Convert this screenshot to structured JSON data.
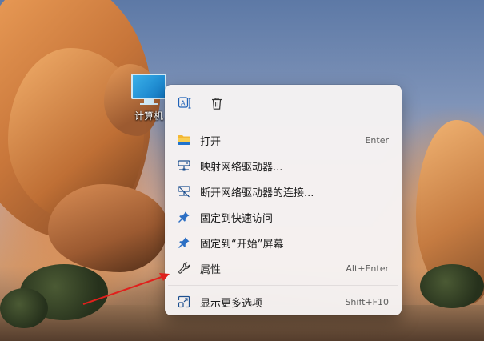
{
  "desktop_icon": {
    "label": "计算机"
  },
  "quick_actions": [
    {
      "name": "rename",
      "icon": "rename-icon"
    },
    {
      "name": "delete",
      "icon": "trash-icon"
    }
  ],
  "menu": {
    "items": [
      {
        "label": "打开",
        "accelerator": "Enter",
        "icon": "folder-icon"
      },
      {
        "label": "映射网络驱动器...",
        "accelerator": "",
        "icon": "network-drive-icon"
      },
      {
        "label": "断开网络驱动器的连接...",
        "accelerator": "",
        "icon": "disconnect-drive-icon"
      },
      {
        "label": "固定到快速访问",
        "accelerator": "",
        "icon": "pin-icon"
      },
      {
        "label": "固定到“开始”屏幕",
        "accelerator": "",
        "icon": "pin-icon"
      },
      {
        "label": "属性",
        "accelerator": "Alt+Enter",
        "icon": "wrench-icon"
      }
    ],
    "more": {
      "label": "显示更多选项",
      "accelerator": "Shift+F10",
      "icon": "show-more-icon"
    }
  },
  "colors": {
    "accent": "#0a5fc7",
    "menu_bg": "#f6f3f3",
    "arrow": "#e0201c"
  }
}
